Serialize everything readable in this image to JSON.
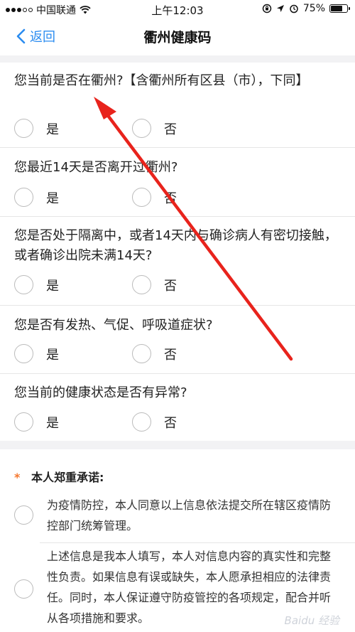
{
  "status_bar": {
    "carrier": "中国联通",
    "time": "上午12:03",
    "battery": "75%",
    "battery_level": 0.75
  },
  "nav": {
    "back_label": "返回",
    "title": "衢州健康码"
  },
  "questions": [
    {
      "text": "您当前是否在衢州?【含衢州所有区县（市），下同】",
      "yes": "是",
      "no": "否"
    },
    {
      "text": "您最近14天是否离开过衢州?",
      "yes": "是",
      "no": "否"
    },
    {
      "text": "您是否处于隔离中，或者14天内与确诊病人有密切接触，或者确诊出院未满14天?",
      "yes": "是",
      "no": "否"
    },
    {
      "text": "您是否有发热、气促、呼吸道症状?",
      "yes": "是",
      "no": "否"
    },
    {
      "text": "您当前的健康状态是否有异常?",
      "yes": "是",
      "no": "否"
    }
  ],
  "commitment": {
    "required_mark": "*",
    "title": "本人郑重承诺:",
    "pledges": [
      "为疫情防控，本人同意以上信息依法提交所在辖区疫情防控部门统筹管理。",
      "上述信息是我本人填写，本人对信息内容的真实性和完整性负责。如果信息有误或缺失，本人愿承担相应的法律责任。同时，本人保证遵守防疫管控的各项规定，配合并听从各项措施和要求。"
    ]
  },
  "watermark": "Baidu 经验",
  "colors": {
    "accent": "#2b8cf0",
    "required": "#f5772e",
    "annotation_arrow": "#e8231c",
    "background": "#f2f2f4"
  }
}
